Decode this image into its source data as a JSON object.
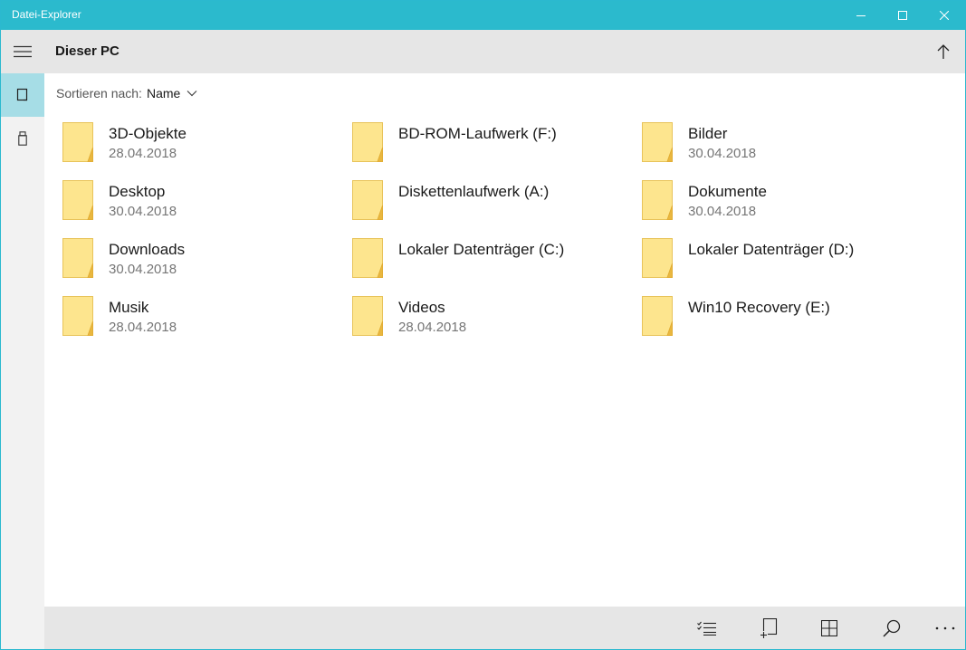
{
  "window": {
    "title": "Datei-Explorer",
    "accent_color": "#2bbacd"
  },
  "header": {
    "title": "Dieser PC"
  },
  "sort": {
    "label": "Sortieren nach:",
    "value": "Name"
  },
  "rail": {
    "items": [
      {
        "icon": "hamburger-menu-icon"
      },
      {
        "icon": "this-pc-icon",
        "selected": true
      },
      {
        "icon": "usb-drive-icon"
      }
    ]
  },
  "items": [
    {
      "name": "3D-Objekte",
      "date": "28.04.2018"
    },
    {
      "name": "BD-ROM-Laufwerk (F:)",
      "date": ""
    },
    {
      "name": "Bilder",
      "date": "30.04.2018"
    },
    {
      "name": "Desktop",
      "date": "30.04.2018"
    },
    {
      "name": "Diskettenlaufwerk (A:)",
      "date": ""
    },
    {
      "name": "Dokumente",
      "date": "30.04.2018"
    },
    {
      "name": "Downloads",
      "date": "30.04.2018"
    },
    {
      "name": "Lokaler Datenträger (C:)",
      "date": ""
    },
    {
      "name": "Lokaler Datenträger (D:)",
      "date": ""
    },
    {
      "name": "Musik",
      "date": "28.04.2018"
    },
    {
      "name": "Videos",
      "date": "28.04.2018"
    },
    {
      "name": "Win10 Recovery (E:)",
      "date": ""
    }
  ],
  "commandbar": {
    "buttons": [
      {
        "icon": "select-list-icon"
      },
      {
        "icon": "new-item-icon"
      },
      {
        "icon": "grid-view-icon"
      },
      {
        "icon": "search-icon"
      },
      {
        "icon": "more-options-icon"
      }
    ]
  }
}
